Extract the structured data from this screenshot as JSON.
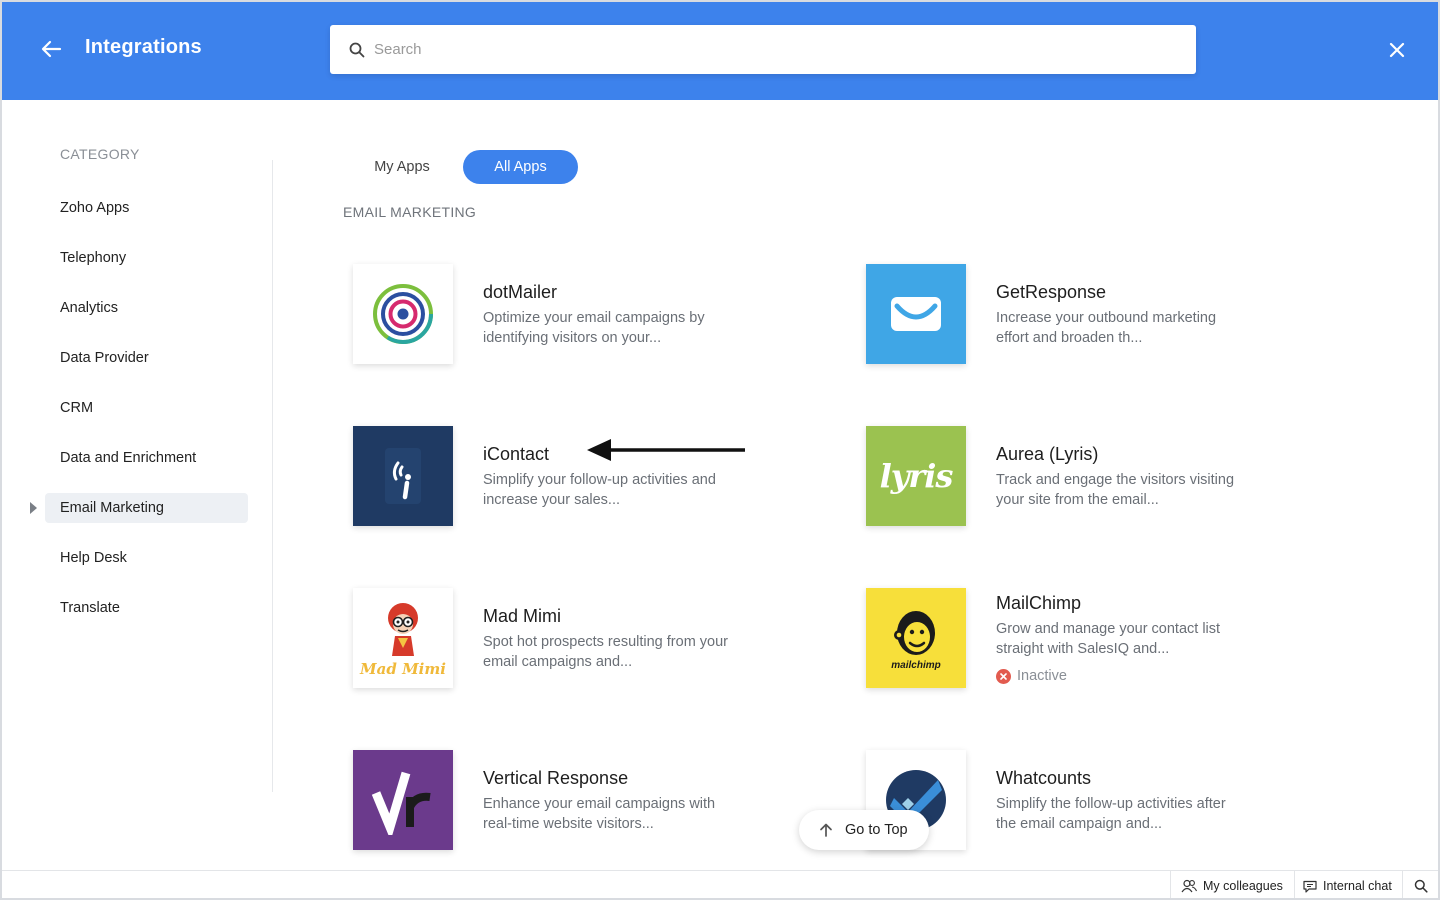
{
  "header": {
    "title": "Integrations",
    "back_icon": "arrow-left-icon",
    "close_icon": "close-icon",
    "search": {
      "placeholder": "Search",
      "value": ""
    }
  },
  "sidebar": {
    "category_label": "CATEGORY",
    "items": [
      {
        "label": "Zoho Apps",
        "active": false
      },
      {
        "label": "Telephony",
        "active": false
      },
      {
        "label": "Analytics",
        "active": false
      },
      {
        "label": "Data Provider",
        "active": false
      },
      {
        "label": "CRM",
        "active": false
      },
      {
        "label": "Data and Enrichment",
        "active": false
      },
      {
        "label": "Email Marketing",
        "active": true
      },
      {
        "label": "Help Desk",
        "active": false
      },
      {
        "label": "Translate",
        "active": false
      }
    ]
  },
  "tabs": [
    {
      "label": "My Apps",
      "active": false
    },
    {
      "label": "All Apps",
      "active": true
    }
  ],
  "section_label": "EMAIL MARKETING",
  "apps": [
    {
      "name": "dotMailer",
      "desc": "Optimize your email campaigns by identifying visitors on your...",
      "logo_color": "#ffffff"
    },
    {
      "name": "GetResponse",
      "desc": "Increase your outbound marketing effort and broaden th...",
      "logo_color": "#3fa6e6"
    },
    {
      "name": "iContact",
      "desc": "Simplify your follow-up activities and increase your sales...",
      "logo_color": "#1f3a63"
    },
    {
      "name": "Aurea (Lyris)",
      "desc": "Track and engage the visitors visiting your site from the email...",
      "logo_color": "#9bc250",
      "logo_text": "lyris"
    },
    {
      "name": "Mad Mimi",
      "desc": "Spot hot prospects resulting from your email campaigns and...",
      "logo_color": "#ffffff",
      "logo_text": "Mad Mimi"
    },
    {
      "name": "MailChimp",
      "desc": "Grow and manage your contact list straight with SalesIQ and...",
      "logo_color": "#f7df3a",
      "logo_text": "mailchimp",
      "status": "Inactive"
    },
    {
      "name": "Vertical Response",
      "desc": "Enhance your email campaigns with real-time website visitors...",
      "logo_color": "#6b3a8c"
    },
    {
      "name": "Whatcounts",
      "desc": "Simplify the follow-up activities after the email campaign and...",
      "logo_color": "#ffffff"
    }
  ],
  "go_to_top": "Go to Top",
  "bottombar": {
    "colleagues": "My colleagues",
    "chat": "Internal chat"
  },
  "colors": {
    "accent": "#3d82ec",
    "inactive": "#e25b4f"
  }
}
